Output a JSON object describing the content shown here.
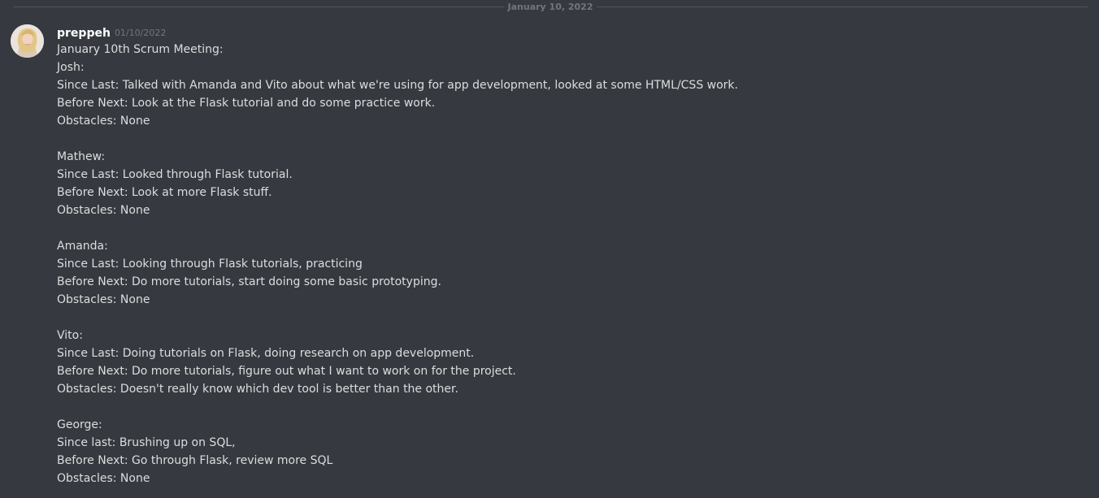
{
  "divider": {
    "date_label": "January 10, 2022"
  },
  "message": {
    "author": "preppeh",
    "timestamp": "01/10/2022",
    "avatar_icon": "user-avatar",
    "lines": [
      "January 10th Scrum Meeting:",
      "Josh:",
      "Since Last: Talked with Amanda and Vito about what we're using for app development, looked at some HTML/CSS work.",
      "Before Next: Look at the Flask tutorial and do some practice work.",
      "Obstacles: None",
      "",
      "Mathew:",
      "Since Last: Looked through Flask tutorial.",
      "Before Next: Look at more Flask stuff.",
      "Obstacles: None",
      "",
      "Amanda:",
      "Since Last: Looking through Flask tutorials, practicing",
      "Before Next: Do more tutorials, start doing some basic prototyping.",
      "Obstacles: None",
      "",
      "Vito:",
      "Since Last: Doing tutorials on Flask, doing research on app development.",
      "Before Next: Do more tutorials, figure out what I want to work on for the project.",
      "Obstacles: Doesn't really know which dev tool is better than the other.",
      "",
      "George:",
      "Since last: Brushing up on SQL,",
      "Before Next: Go through Flask, review more SQL",
      "Obstacles: None"
    ]
  },
  "colors": {
    "background": "#36393f",
    "text": "#dcddde",
    "username": "#ffffff",
    "muted": "#72767d",
    "divider": "#4f545c"
  }
}
